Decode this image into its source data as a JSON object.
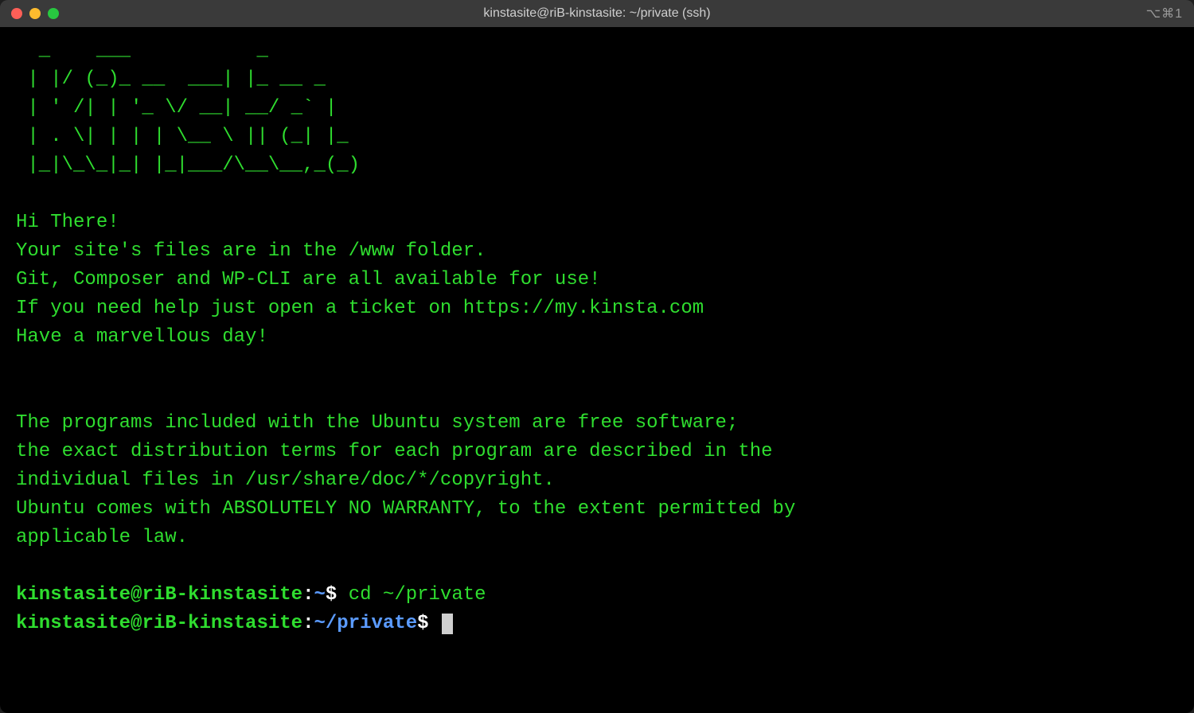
{
  "colors": {
    "bg": "#000000",
    "fg": "#2fdd2f",
    "title_bar": "#3a3a3a",
    "title_text": "#cfcfcf",
    "path": "#5b9bff",
    "white": "#ffffff"
  },
  "title_bar": {
    "title": "kinstasite@riB-kinstasite: ~/private (ssh)",
    "right_indicator": "⌥⌘1",
    "traffic_lights": [
      "close",
      "minimize",
      "zoom"
    ]
  },
  "ascii_art": [
    "  _    ___           _         ",
    " | |/ (_)_ __  ___| |_ __ _  ",
    " | ' /| | '_ \\/ __| __/ _` | ",
    " | . \\| | | | \\__ \\ || (_| |_",
    " |_|\\_\\_|_| |_|___/\\__\\__,_(_)"
  ],
  "motd": [
    "Hi There!",
    "Your site's files are in the /www folder.",
    "Git, Composer and WP-CLI are all available for use!",
    "If you need help just open a ticket on https://my.kinsta.com",
    "Have a marvellous day!"
  ],
  "legal": [
    "The programs included with the Ubuntu system are free software;",
    "the exact distribution terms for each program are described in the",
    "individual files in /usr/share/doc/*/copyright.",
    "",
    "Ubuntu comes with ABSOLUTELY NO WARRANTY, to the extent permitted by",
    "applicable law."
  ],
  "prompts": [
    {
      "user": "kinstasite",
      "host": "riB-kinstasite",
      "path": "~",
      "command": "cd ~/private"
    },
    {
      "user": "kinstasite",
      "host": "riB-kinstasite",
      "path": "~/private",
      "command": "",
      "cursor": true
    }
  ]
}
